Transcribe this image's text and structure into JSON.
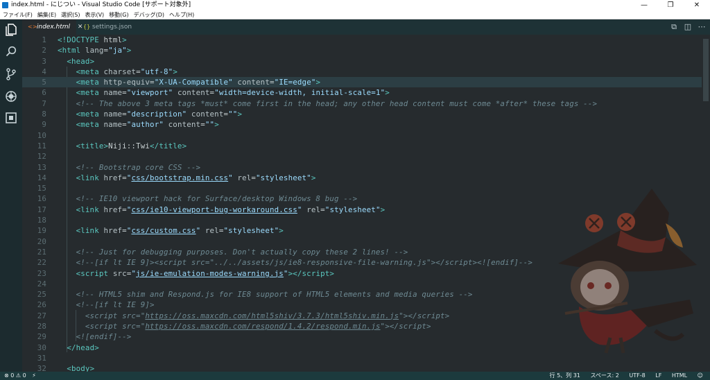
{
  "window": {
    "title": "index.html - にじつい - Visual Studio Code [サポート対象外]",
    "controls": {
      "minimize": "—",
      "restore": "❐",
      "close": "✕"
    }
  },
  "menu": [
    "ファイル(F)",
    "編集(E)",
    "選択(S)",
    "表示(V)",
    "移動(G)",
    "デバッグ(D)",
    "ヘルプ(H)"
  ],
  "activity_icons": [
    "files-icon",
    "search-icon",
    "source-control-icon",
    "debug-icon",
    "extensions-icon"
  ],
  "tabs": [
    {
      "label": "index.html",
      "icon": "<>",
      "active": true,
      "close": "✕"
    },
    {
      "label": "settings.json",
      "icon": "{}",
      "active": false
    }
  ],
  "editor_actions": [
    "split-compare-icon",
    "split-editor-icon",
    "more-icon"
  ],
  "code_lines": [
    {
      "n": "1",
      "html": "<span class=\"t\">&lt;!DOCTYPE</span> html<span class=\"t\">&gt;</span>"
    },
    {
      "n": "2",
      "html": "<span class=\"t\">&lt;html</span> <span class=\"a\">lang</span>=<span class=\"s\">\"ja\"</span><span class=\"t\">&gt;</span>"
    },
    {
      "n": "3",
      "html": "  <span class=\"t\">&lt;head&gt;</span>"
    },
    {
      "n": "4",
      "html": "    <span class=\"t\">&lt;meta</span> <span class=\"a\">charset</span>=<span class=\"s\">\"utf-8\"</span><span class=\"t\">&gt;</span>"
    },
    {
      "n": "5",
      "html": "    <span class=\"t\">&lt;meta</span> <span class=\"a\">http-equiv</span>=<span class=\"s\">\"X-UA-Compatible\"</span> <span class=\"a\">content</span>=<span class=\"s\">\"IE=edge\"</span><span class=\"t\">&gt;</span>",
      "current": true
    },
    {
      "n": "6",
      "html": "    <span class=\"t\">&lt;meta</span> <span class=\"a\">name</span>=<span class=\"s\">\"viewport\"</span> <span class=\"a\">content</span>=<span class=\"s\">\"width=device-width, initial-scale=1\"</span><span class=\"t\">&gt;</span>"
    },
    {
      "n": "7",
      "html": "    <span class=\"c\">&lt;!-- The above 3 meta tags *must* come first in the head; any other head content must come *after* these tags --&gt;</span>"
    },
    {
      "n": "8",
      "html": "    <span class=\"t\">&lt;meta</span> <span class=\"a\">name</span>=<span class=\"s\">\"description\"</span> <span class=\"a\">content</span>=<span class=\"s\">\"\"</span><span class=\"t\">&gt;</span>"
    },
    {
      "n": "9",
      "html": "    <span class=\"t\">&lt;meta</span> <span class=\"a\">name</span>=<span class=\"s\">\"author\"</span> <span class=\"a\">content</span>=<span class=\"s\">\"\"</span><span class=\"t\">&gt;</span>"
    },
    {
      "n": "10",
      "html": ""
    },
    {
      "n": "11",
      "html": "    <span class=\"t\">&lt;title&gt;</span>Niji::Twi<span class=\"t\">&lt;/title&gt;</span>"
    },
    {
      "n": "12",
      "html": ""
    },
    {
      "n": "13",
      "html": "    <span class=\"c\">&lt;!-- Bootstrap core CSS --&gt;</span>"
    },
    {
      "n": "14",
      "html": "    <span class=\"t\">&lt;link</span> <span class=\"a\">href</span>=<span class=\"s\">\"<span class=\"u\">css/bootstrap.min.css</span>\"</span> <span class=\"a\">rel</span>=<span class=\"s\">\"stylesheet\"</span><span class=\"t\">&gt;</span>"
    },
    {
      "n": "15",
      "html": ""
    },
    {
      "n": "16",
      "html": "    <span class=\"c\">&lt;!-- IE10 viewport hack for Surface/desktop Windows 8 bug --&gt;</span>"
    },
    {
      "n": "17",
      "html": "    <span class=\"t\">&lt;link</span> <span class=\"a\">href</span>=<span class=\"s\">\"<span class=\"u\">css/ie10-viewport-bug-workaround.css</span>\"</span> <span class=\"a\">rel</span>=<span class=\"s\">\"stylesheet\"</span><span class=\"t\">&gt;</span>"
    },
    {
      "n": "18",
      "html": ""
    },
    {
      "n": "19",
      "html": "    <span class=\"t\">&lt;link</span> <span class=\"a\">href</span>=<span class=\"s\">\"<span class=\"u\">css/custom.css</span>\"</span> <span class=\"a\">rel</span>=<span class=\"s\">\"stylesheet\"</span><span class=\"t\">&gt;</span>"
    },
    {
      "n": "20",
      "html": ""
    },
    {
      "n": "21",
      "html": "    <span class=\"c\">&lt;!-- Just for debugging purposes. Don't actually copy these 2 lines! --&gt;</span>"
    },
    {
      "n": "22",
      "html": "    <span class=\"c\">&lt;!--[if lt IE 9]&gt;&lt;script src=\"../../assets/js/ie8-responsive-file-warning.js\"&gt;&lt;/script&gt;&lt;![endif]--&gt;</span>"
    },
    {
      "n": "23",
      "html": "    <span class=\"t\">&lt;script</span> <span class=\"a\">src</span>=<span class=\"s\">\"<span class=\"u\">js/ie-emulation-modes-warning.js</span>\"</span><span class=\"t\">&gt;&lt;/script&gt;</span>"
    },
    {
      "n": "24",
      "html": ""
    },
    {
      "n": "25",
      "html": "    <span class=\"c\">&lt;!-- HTML5 shim and Respond.js for IE8 support of HTML5 elements and media queries --&gt;</span>"
    },
    {
      "n": "26",
      "html": "    <span class=\"c\">&lt;!--[if lt IE 9]&gt;</span>"
    },
    {
      "n": "27",
      "html": "      <span class=\"c\">&lt;script src=\"<span class=\"u\">https://oss.maxcdn.com/html5shiv/3.7.3/html5shiv.min.js</span>\"&gt;&lt;/script&gt;</span>"
    },
    {
      "n": "28",
      "html": "      <span class=\"c\">&lt;script src=\"<span class=\"u\">https://oss.maxcdn.com/respond/1.4.2/respond.min.js</span>\"&gt;&lt;/script&gt;</span>"
    },
    {
      "n": "29",
      "html": "    <span class=\"c\">&lt;![endif]--&gt;</span>"
    },
    {
      "n": "30",
      "html": "  <span class=\"t\">&lt;/head&gt;</span>"
    },
    {
      "n": "31",
      "html": ""
    },
    {
      "n": "32",
      "html": "  <span class=\"t\">&lt;body&gt;</span>"
    }
  ],
  "status": {
    "errors": "0",
    "warnings": "0",
    "position": "行 5、列 31",
    "indent": "スペース: 2",
    "encoding": "UTF-8",
    "eol": "LF",
    "language": "HTML",
    "feedback_icon": "smiley-icon"
  },
  "colors": {
    "background": "#262B2E",
    "tabbar": "#1E3236",
    "statusbar": "#1C3A3D",
    "tag": "#5BC8C0",
    "string": "#9CDCFE",
    "comment": "#6E8A93"
  }
}
